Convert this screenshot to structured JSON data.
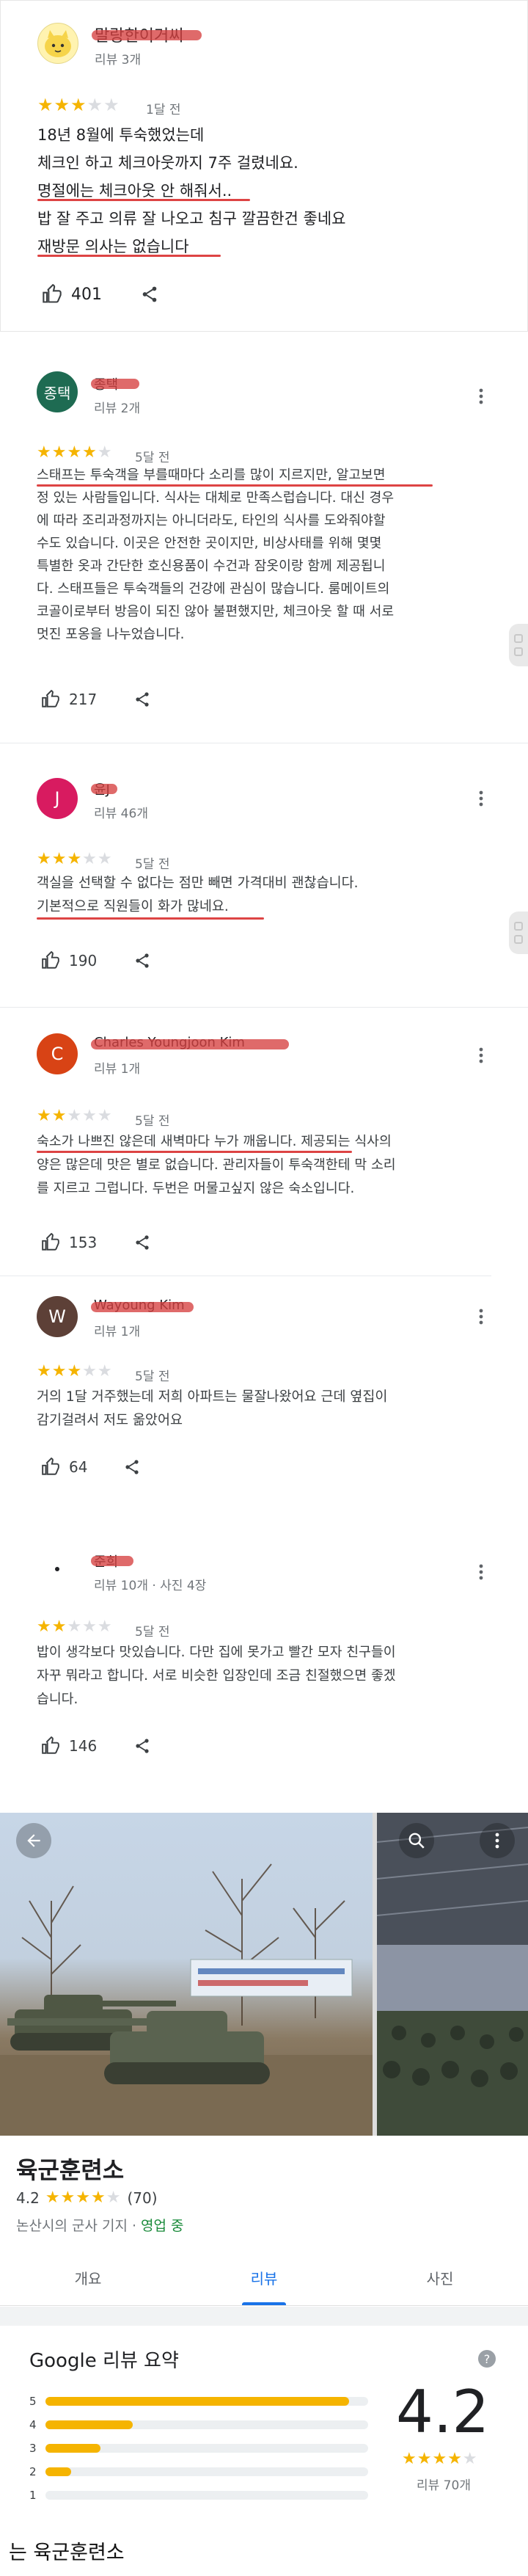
{
  "reviews": [
    {
      "name": "말랑한이거씨",
      "count": "리뷰 3개",
      "rating": 3,
      "ago": "1달 전",
      "lines": [
        "18년 8월에 투숙했었는데",
        "체크인 하고 체크아웃까지 7주 걸렸네요.",
        "명절에는 체크아웃 안 해줘서..",
        "밥 잘 주고 의류 잘 나오고 침구 깔끔한건 좋네요",
        "재방문 의사는 없습니다"
      ],
      "likes": "401"
    },
    {
      "name": "종택",
      "avatar_text": "종택",
      "avatar_color": "#1e6b52",
      "count": "리뷰 2개",
      "rating": 4,
      "ago": "5달 전",
      "lines": [
        "스태프는 투숙객을 부를때마다 소리를 많이 지르지만, 알고보면",
        "정 있는 사람들입니다. 식사는 대체로 만족스럽습니다. 대신 경우",
        "에 따라 조리과정까지는 아니더라도, 타인의 식사를 도와줘야할",
        "수도 있습니다. 이곳은 안전한 곳이지만, 비상사태를 위해 몇몇",
        "특별한 옷과 간단한 호신용품이 수건과 잠옷이랑 함께 제공됩니",
        "다. 스태프들은 투숙객들의 건강에 관심이 많습니다. 룸메이트의",
        "코골이로부터 방음이 되진 않아 불편했지만, 체크아웃 할 때 서로",
        "멋진 포옹을 나누었습니다."
      ],
      "likes": "217"
    },
    {
      "name": "윤J",
      "avatar_text": "J",
      "avatar_color": "#d81b60",
      "count": "리뷰 46개",
      "rating": 3,
      "ago": "5달 전",
      "lines": [
        "객실을 선택할 수 없다는 점만 빼면 가격대비 괜찮습니다.",
        "기본적으로 직원들이 화가 많네요."
      ],
      "likes": "190"
    },
    {
      "name": "Charles Youngjoon Kim",
      "avatar_text": "C",
      "avatar_color": "#d84315",
      "count": "리뷰 1개",
      "rating": 2,
      "ago": "5달 전",
      "lines": [
        "숙소가 나쁘진 않은데 새벽마다 누가 깨웁니다. 제공되는 식사의",
        "양은 많은데 맛은 별로 없습니다. 관리자들이 투숙객한테 막 소리",
        "를 지르고 그럽니다. 두번은 머물고싶지 않은 숙소입니다."
      ],
      "likes": "153"
    },
    {
      "name": "Wayoung Kim",
      "avatar_text": "W",
      "avatar_color": "#5d4037",
      "count": "리뷰 1개",
      "rating": 3,
      "ago": "5달 전",
      "lines": [
        "거의 1달 거주했는데 저희 아파트는 물잘나왔어요 근데 옆집이",
        "감기걸려서 저도 옮았어요"
      ],
      "likes": "64"
    },
    {
      "name": "준희",
      "count": "리뷰 10개 · 사진 4장",
      "rating": 2,
      "ago": "5달 전",
      "lines": [
        "밥이 생각보다 맛있습니다. 다만 집에 못가고 빨간 모자 친구들이",
        "자꾸 뭐라고 합니다. 서로 비슷한 입장인데 조금 친절했으면 좋겠",
        "습니다."
      ],
      "likes": "146"
    }
  ],
  "place": {
    "title": "육군훈련소",
    "rating": "4.2",
    "rating_count": "(70)",
    "category": "논산시의 군사 기지",
    "separator": " · ",
    "status": "영업 중"
  },
  "tabs": [
    "개요",
    "리뷰",
    "사진"
  ],
  "active_tab": 1,
  "summary": {
    "title": "Google 리뷰 요약",
    "help": "?",
    "rows": [
      {
        "label": "5",
        "fraction": 0.94
      },
      {
        "label": "4",
        "fraction": 0.27
      },
      {
        "label": "3",
        "fraction": 0.17
      },
      {
        "label": "2",
        "fraction": 0.08
      },
      {
        "label": "1",
        "fraction": 0.0
      }
    ],
    "rating": "4.2",
    "stars": "★★★★",
    "count": "리뷰 70개"
  },
  "caption": "는 육군훈련소",
  "colors": {
    "star": "#f5b400",
    "accent": "#1a73e8",
    "redact": "#d64040",
    "open": "#1a8a3a"
  }
}
